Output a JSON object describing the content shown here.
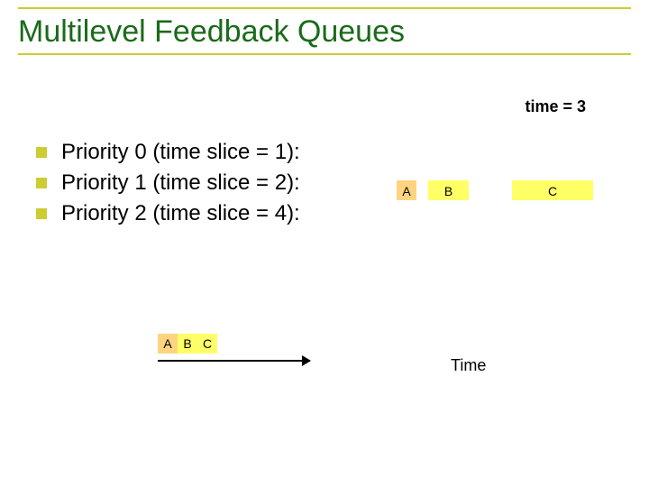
{
  "title": "Multilevel Feedback Queues",
  "time_counter": "time = 3",
  "bullets": [
    "Priority 0 (time slice = 1):",
    "Priority 1 (time slice = 2):",
    "Priority 2 (time slice = 4):"
  ],
  "queue_row": {
    "A": "A",
    "B": "B",
    "C": "C"
  },
  "timeline": {
    "boxes": [
      "A",
      "B",
      "C"
    ],
    "axis_label": "Time"
  }
}
